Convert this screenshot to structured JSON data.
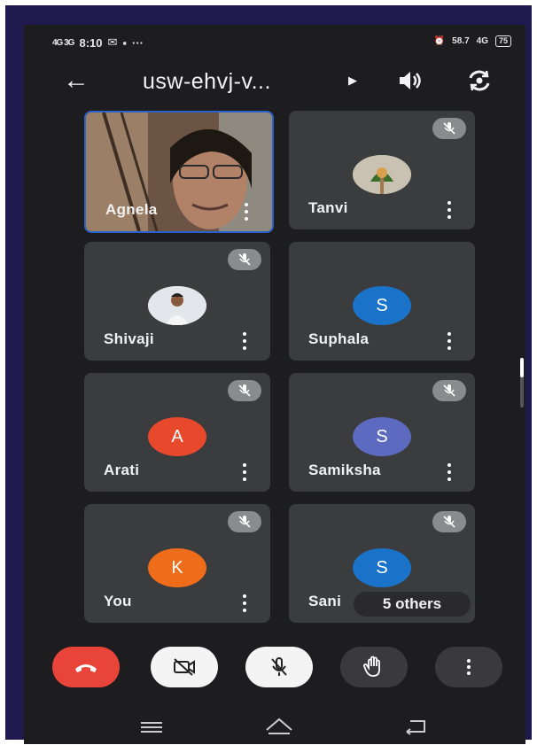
{
  "status_bar": {
    "signal_left": "4G 3G",
    "time": "8:10",
    "more": "···",
    "net_speed": "58.7",
    "net_type": "4G",
    "battery": "75"
  },
  "header": {
    "meeting_code": "usw-ehvj-v...",
    "back_icon": "arrow-left-icon",
    "speaker_icon": "speaker-icon",
    "flip_camera_icon": "flip-camera-icon"
  },
  "participants": [
    {
      "name": "Agnela",
      "muted": false,
      "type": "video"
    },
    {
      "name": "Tanvi",
      "muted": true,
      "type": "photo"
    },
    {
      "name": "Shivaji",
      "muted": true,
      "type": "photo"
    },
    {
      "name": "Suphala",
      "muted": false,
      "type": "initial",
      "initial": "S",
      "color": "#1a73c8"
    },
    {
      "name": "Arati",
      "muted": true,
      "type": "initial",
      "initial": "A",
      "color": "#e8482c"
    },
    {
      "name": "Samiksha",
      "muted": true,
      "type": "initial",
      "initial": "S",
      "color": "#5c6bc0"
    },
    {
      "name": "You",
      "muted": true,
      "type": "initial",
      "initial": "K",
      "color": "#ef6c1a"
    },
    {
      "name": "Sani",
      "muted": true,
      "type": "initial",
      "initial": "S",
      "color": "#1a73c8"
    }
  ],
  "others_chip": "5 others",
  "controls": {
    "end_call": "end-call-icon",
    "camera_off": "camera-off-icon",
    "mic_off": "mic-off-icon",
    "raise_hand": "raise-hand-icon",
    "more": "more-vert-icon"
  },
  "nav": {
    "menu": "menu-icon",
    "home": "home-icon",
    "back": "back-nav-icon"
  }
}
